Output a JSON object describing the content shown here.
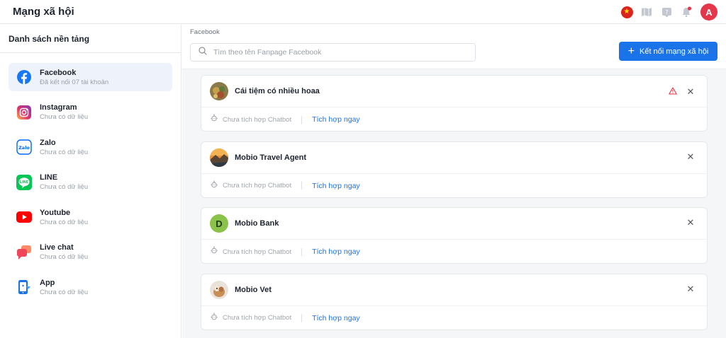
{
  "app": {
    "title": "Mạng xã hội"
  },
  "header": {
    "icons": [
      "vietnam-flag-icon",
      "map-book-icon",
      "help-icon",
      "notification-bell-icon"
    ],
    "avatar_letter": "A"
  },
  "sidebar": {
    "title": "Danh sách nền tảng",
    "items": [
      {
        "name": "Facebook",
        "sub": "Đã kết nối 07 tài khoản",
        "icon": "facebook-icon",
        "active": true
      },
      {
        "name": "Instagram",
        "sub": "Chưa có dữ liệu",
        "icon": "instagram-icon"
      },
      {
        "name": "Zalo",
        "sub": "Chưa có dữ liệu",
        "icon": "zalo-icon"
      },
      {
        "name": "LINE",
        "sub": "Chưa có dữ liệu",
        "icon": "line-icon"
      },
      {
        "name": "Youtube",
        "sub": "Chưa có dữ liệu",
        "icon": "youtube-icon"
      },
      {
        "name": "Live chat",
        "sub": "Chưa có dữ liệu",
        "icon": "live-chat-icon"
      },
      {
        "name": "App",
        "sub": "Chưa có dữ liệu",
        "icon": "app-icon"
      }
    ]
  },
  "main": {
    "breadcrumb": "Facebook",
    "search": {
      "placeholder": "Tìm theo tên Fanpage Facebook"
    },
    "connect_button": "Kết nối mạng xã hội",
    "pages": [
      {
        "name": "Cái tiệm có nhiều hoaa",
        "status": "Chưa tích hợp Chatbot",
        "action": "Tích hợp ngay",
        "warning": true,
        "avatar": "flower-avatar"
      },
      {
        "name": "Mobio Travel Agent",
        "status": "Chưa tích hợp Chatbot",
        "action": "Tích hợp ngay",
        "warning": false,
        "avatar": "travel-avatar"
      },
      {
        "name": "Mobio Bank",
        "status": "Chưa tích hợp Chatbot",
        "action": "Tích hợp ngay",
        "warning": false,
        "avatar": "letter-avatar",
        "avatar_letter": "D"
      },
      {
        "name": "Mobio Vet",
        "status": "Chưa tích hợp Chatbot",
        "action": "Tích hợp ngay",
        "warning": false,
        "avatar": "pet-avatar"
      }
    ]
  },
  "colors": {
    "accent": "#1a73e8",
    "warning": "#e5364b",
    "active_bg": "#eef3fb"
  }
}
